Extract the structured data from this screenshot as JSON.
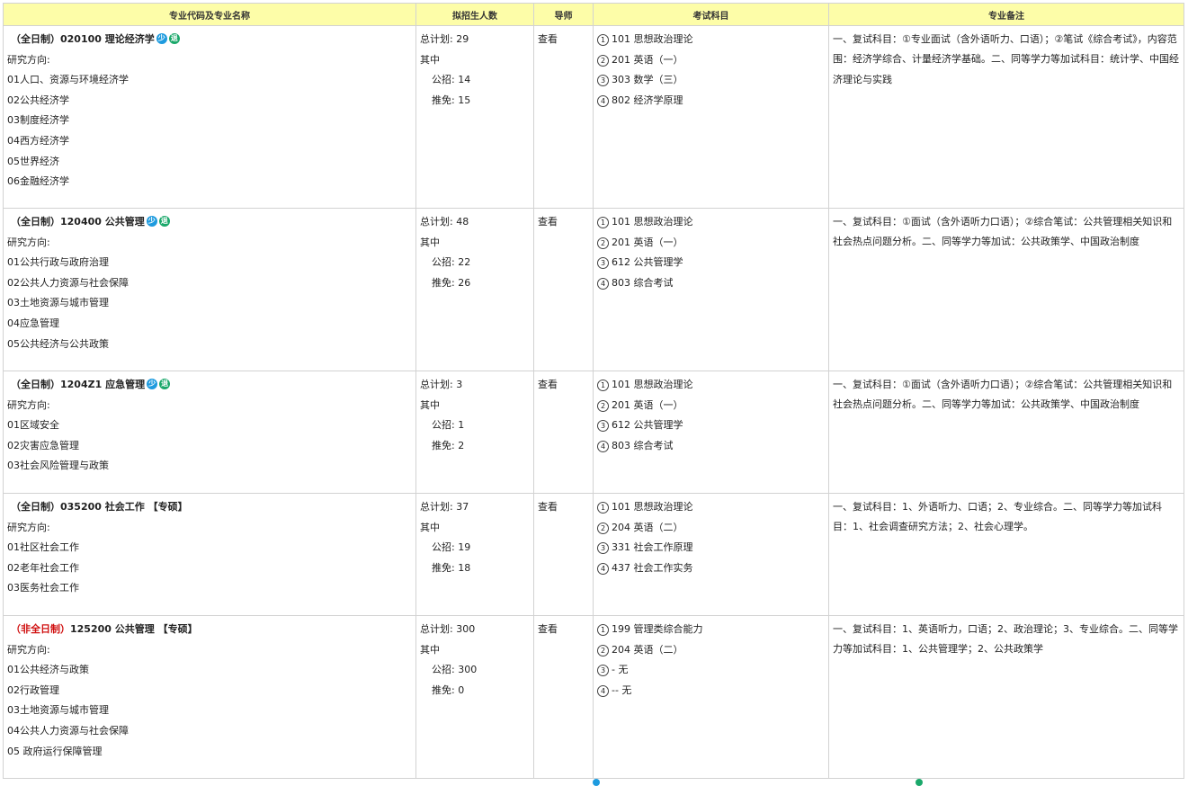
{
  "header": {
    "col_major": "专业代码及专业名称",
    "col_quota": "拟招生人数",
    "col_tutor": "导师",
    "col_exams": "考试科目",
    "col_remark": "专业备注"
  },
  "labels": {
    "research_direction": "研究方向:",
    "total_plan": "总计划:",
    "among": "其中",
    "public_exam": "公招:",
    "recommend": "推免:",
    "view": "查看"
  },
  "rows": [
    {
      "mode": "（全日制）",
      "code_name": "020100 理论经济学",
      "suffix": "",
      "icons": true,
      "directions": [
        "01人口、资源与环境经济学",
        "02公共经济学",
        "03制度经济学",
        "04西方经济学",
        "05世界经济",
        "06金融经济学"
      ],
      "total": "29",
      "public": "14",
      "recommend": "15",
      "exams": [
        {
          "num": "1",
          "text": "101 思想政治理论"
        },
        {
          "num": "2",
          "text": "201 英语（一）"
        },
        {
          "num": "3",
          "text": "303 数学（三）"
        },
        {
          "num": "4",
          "text": "802 经济学原理"
        }
      ],
      "remark": "一、复试科目：①专业面试（含外语听力、口语）；②笔试《综合考试》，内容范围：经济学综合、计量经济学基础。二、同等学力等加试科目：统计学、中国经济理论与实践"
    },
    {
      "mode": "（全日制）",
      "code_name": "120400 公共管理",
      "suffix": "",
      "icons": true,
      "directions": [
        "01公共行政与政府治理",
        "02公共人力资源与社会保障",
        "03土地资源与城市管理",
        "04应急管理",
        "05公共经济与公共政策"
      ],
      "total": "48",
      "public": "22",
      "recommend": "26",
      "exams": [
        {
          "num": "1",
          "text": "101 思想政治理论"
        },
        {
          "num": "2",
          "text": "201 英语（一）"
        },
        {
          "num": "3",
          "text": "612 公共管理学"
        },
        {
          "num": "4",
          "text": "803 综合考试"
        }
      ],
      "remark": "一、复试科目：①面试（含外语听力口语）；②综合笔试：公共管理相关知识和社会热点问题分析。二、同等学力等加试：公共政策学、中国政治制度"
    },
    {
      "mode": "（全日制）",
      "code_name": "1204Z1 应急管理",
      "suffix": "",
      "icons": true,
      "directions": [
        "01区域安全",
        "02灾害应急管理",
        "03社会风险管理与政策"
      ],
      "total": "3",
      "public": "1",
      "recommend": "2",
      "exams": [
        {
          "num": "1",
          "text": "101 思想政治理论"
        },
        {
          "num": "2",
          "text": "201 英语（一）"
        },
        {
          "num": "3",
          "text": "612 公共管理学"
        },
        {
          "num": "4",
          "text": "803 综合考试"
        }
      ],
      "remark": "一、复试科目：①面试（含外语听力口语）；②综合笔试：公共管理相关知识和社会热点问题分析。二、同等学力等加试：公共政策学、中国政治制度"
    },
    {
      "mode": "（全日制）",
      "code_name": "035200 社会工作",
      "suffix": "【专硕】",
      "icons": false,
      "directions": [
        "01社区社会工作",
        "02老年社会工作",
        "03医务社会工作"
      ],
      "total": "37",
      "public": "19",
      "recommend": "18",
      "exams": [
        {
          "num": "1",
          "text": "101 思想政治理论"
        },
        {
          "num": "2",
          "text": "204 英语（二）"
        },
        {
          "num": "3",
          "text": "331 社会工作原理"
        },
        {
          "num": "4",
          "text": "437 社会工作实务"
        }
      ],
      "remark": "一、复试科目：1、外语听力、口语；2、专业综合。二、同等学力等加试科目：1、社会调查研究方法；2、社会心理学。"
    },
    {
      "mode": "（非全日制）",
      "code_name": "125200 公共管理",
      "suffix": "【专硕】",
      "icons": false,
      "directions": [
        "01公共经济与政策",
        "02行政管理",
        "03土地资源与城市管理",
        "04公共人力资源与社会保障",
        "05 政府运行保障管理"
      ],
      "total": "300",
      "public": "300",
      "recommend": "0",
      "exams": [
        {
          "num": "1",
          "text": "199 管理类综合能力"
        },
        {
          "num": "2",
          "text": "204 英语（二）"
        },
        {
          "num": "3",
          "text": "- 无"
        },
        {
          "num": "4",
          "text": "-- 无"
        }
      ],
      "remark": "一、复试科目：1、英语听力，口语；2、政治理论；3、专业综合。二、同等学力等加试科目：1、公共管理学；2、公共政策学"
    }
  ],
  "colors": {
    "header_bg": "#fdfda8",
    "border": "#d2d2d2",
    "part_time": "#d01010",
    "icon_blue": "#1e9bdf",
    "icon_green": "#1aa86a"
  }
}
